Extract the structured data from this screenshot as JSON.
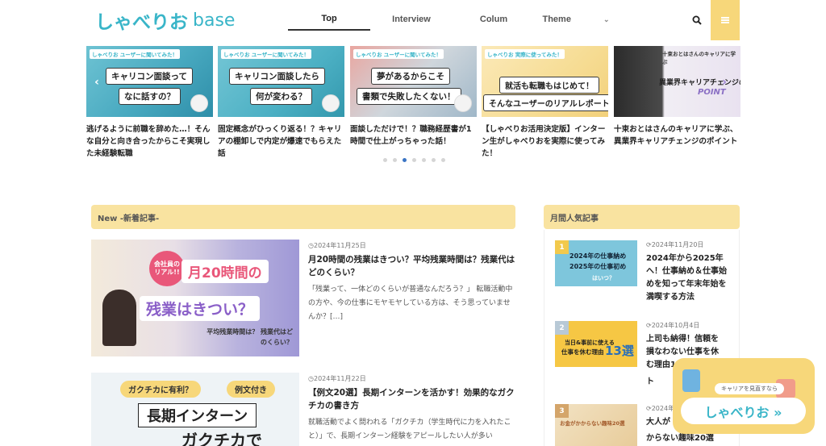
{
  "header": {
    "logo_jp": "しゃべりお",
    "logo_en": "base",
    "nav": [
      {
        "label": "Top",
        "active": true
      },
      {
        "label": "Interview",
        "active": false
      },
      {
        "label": "Colum",
        "active": false
      },
      {
        "label": "Theme",
        "active": false
      }
    ]
  },
  "carousel": {
    "slides": [
      {
        "tag": "しゃべりお ユーザーに聞いてみた！",
        "bubble1": "キャリコン面談って",
        "bubble2": "なに話すの？",
        "caption": "逃げるように前職を辞めた…！そんな自分と向き合ったからこそ実現した未経験転職"
      },
      {
        "tag": "しゃべりお ユーザーに聞いてみた！",
        "bubble1": "キャリコン面談したら",
        "bubble2": "何が変わる？",
        "caption": "固定概念がひっくり返る！？キャリアの棚卸しで内定が爆速でもらえた話"
      },
      {
        "tag": "しゃべりお ユーザーに聞いてみた！",
        "bubble1": "夢があるからこそ",
        "bubble2": "書類で失敗したくない！",
        "caption": "面談しただけで！？職務経歴書が1時間で仕上がっちゃった話！"
      },
      {
        "tag": "しゃべりお 実際に使ってみた！",
        "bubble1": "就活も転職もはじめて！",
        "bubble2": "そんなユーザーのリアルレポート",
        "caption": "【しゃべりお活用決定版】インターン生がしゃべりおを実際に使ってみた！"
      },
      {
        "tag": "十束おとはさんのキャリアに学ぶ",
        "bubble1": "異業界キャリアチェンジの",
        "bubble2": "POINT",
        "caption": "十束おとはさんのキャリアに学ぶ、異業界キャリアチェンジのポイント"
      }
    ]
  },
  "new_section": {
    "heading": "New -新着記事-"
  },
  "articles": [
    {
      "img_tag": "会社員の リアル!!",
      "img_line1": "月20時間の",
      "img_line2": "残業はきつい？",
      "img_sub": "平均残業時間は？ 残業代はどのくらい？",
      "date": "2024年11月25日",
      "title": "月20時間の残業はきつい？平均残業時間は？残業代はどのくらい？",
      "excerpt": "「残業って、一体どのくらいが普通なんだろう？」 転職活動中の方や、今の仕事にモヤモヤしている方は、そう思っていませんか？[…]"
    },
    {
      "img_tag": "ガクチカに有利？",
      "img_tag2": "例文付き",
      "img_line1": "長期インターン",
      "img_line2": "ガクチカで",
      "date": "2024年11月22日",
      "title": "【例文20選】長期インターンを活かす！効果的なガクチカの書き方",
      "excerpt": "就職活動でよく問われる「ガクチカ（学生時代に力を入れたこと）」で、長期インターン経験をアピールしたい人が多い"
    }
  ],
  "sidebar": {
    "heading": "月間人気記事",
    "items": [
      {
        "num": "1",
        "img_text1": "2024年の仕事納め",
        "img_text2": "2025年の仕事初め",
        "img_text3": "はいつ？",
        "date": "2024年11月20日",
        "title": "2024年から2025年へ！仕事納め＆仕事始めを知って年末年始を満喫する方法"
      },
      {
        "num": "2",
        "img_text1": "当日&事前に使える",
        "img_text2": "仕事を休む理由",
        "img_text3": "13選",
        "date": "2024年10月4日",
        "title": "上司も納得！信頼を損なわない仕事を休む理由13選",
        "title_tail": "ト"
      },
      {
        "num": "3",
        "img_text1": "お金がかからない趣味20選",
        "date": "2024年",
        "title": "大人が",
        "title2": "からない趣味20選"
      }
    ]
  },
  "float_banner": {
    "small": "キャリアを見直すなら",
    "label": "しゃべりお »"
  },
  "colors": {
    "accent_yellow": "#f7d77a",
    "brand_teal": "#39b5c8",
    "dot_active": "#3a74c4"
  }
}
